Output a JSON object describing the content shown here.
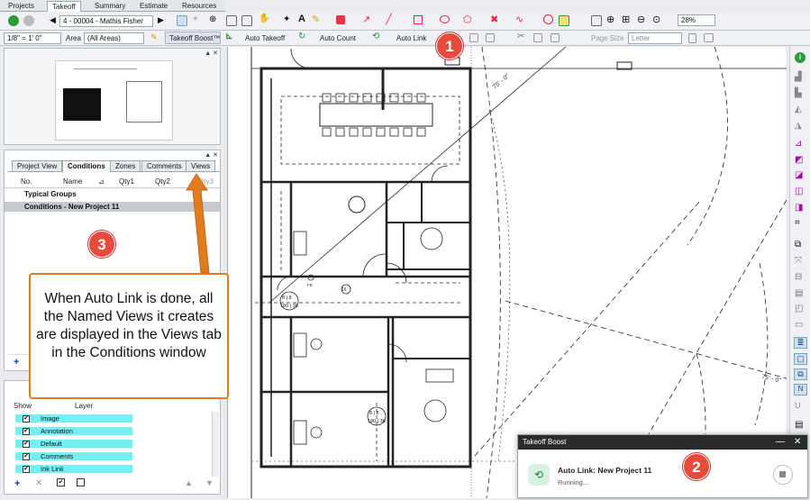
{
  "tabs": [
    "Projects",
    "Takeoff",
    "Summary",
    "Estimate",
    "Resources"
  ],
  "toolbar": {
    "page_select": "4 - 00004 - Mathis Fisher",
    "zoom_level": "28%",
    "scale": "1/8\" = 1' 0\"",
    "area_label": "Area",
    "area_value": "(All Areas)",
    "takeoff_boost": "Takeoff Boost™",
    "auto_takeoff": "Auto Takeoff",
    "auto_count": "Auto Count",
    "auto_link": "Auto Link",
    "page_size_label": "Page Size",
    "page_size_value": "Letter"
  },
  "conditions": {
    "tabs": [
      "Project View",
      "Conditions",
      "Zones",
      "Comments",
      "Views"
    ],
    "columns": [
      "No.",
      "Name",
      "Qty1",
      "Qty2",
      "Qty3"
    ],
    "rows": [
      "Typical Groups",
      "Conditions - New Project 11"
    ]
  },
  "layers": {
    "columns": [
      "Show",
      "Layer"
    ],
    "items": [
      "Image",
      "Annotation",
      "Default",
      "Comments",
      "Ink Link"
    ]
  },
  "callout": {
    "text": "When Auto Link is done, all the Named Views it creates are displayed in the Views tab in the Conditions window"
  },
  "badges": [
    "1",
    "2",
    "3"
  ],
  "toast": {
    "header": "Takeoff Boost",
    "title": "Auto Link: New Project 11",
    "status": "Running..."
  },
  "drawing": {
    "dim_labels": [
      "75' - 0\"",
      "75' - 0\""
    ],
    "room_tags": [
      "8 | 8",
      "180 | 36",
      "16",
      "FE"
    ]
  },
  "colors": {
    "accent": "#e07b1e",
    "badge": "#e84a3c",
    "layer_row": "#74f0f3",
    "toast_icon": "#d8f0e1"
  }
}
